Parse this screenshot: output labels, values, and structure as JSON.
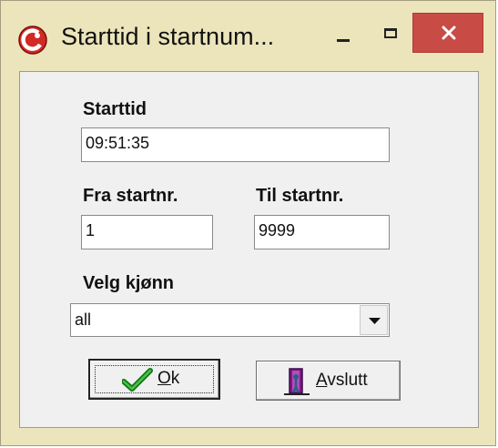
{
  "window": {
    "title": "Starttid i startnum...",
    "icon": "app-logo-icon",
    "controls": {
      "minimize": "minimize-icon",
      "maximize": "maximize-icon",
      "close": "close-icon"
    },
    "close_color": "#c84b45"
  },
  "form": {
    "starttid": {
      "label": "Starttid",
      "value": "09:51:35"
    },
    "fra_startnr": {
      "label": "Fra startnr.",
      "value": "1"
    },
    "til_startnr": {
      "label": "Til startnr.",
      "value": "9999"
    },
    "kjonn": {
      "label": "Velg kjønn",
      "value": "all"
    }
  },
  "buttons": {
    "ok": {
      "mnemonic": "O",
      "rest": "k",
      "icon": "checkmark-icon"
    },
    "exit": {
      "mnemonic": "A",
      "rest": "vslutt",
      "icon": "door-exit-icon"
    }
  }
}
